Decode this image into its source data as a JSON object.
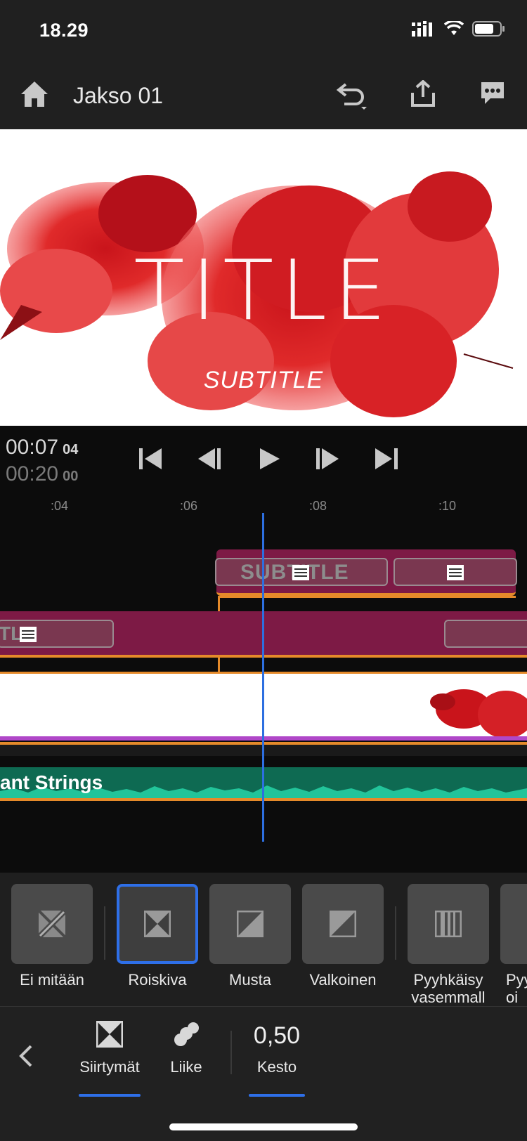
{
  "status": {
    "time": "18.29"
  },
  "header": {
    "title": "Jakso 01"
  },
  "preview": {
    "title": "TITLE",
    "subtitle": "SUBTITLE"
  },
  "transport": {
    "current": "00:07",
    "current_frames": "04",
    "total": "00:20",
    "total_frames": "00"
  },
  "ruler": {
    "ticks": [
      ":04",
      ":06",
      ":08",
      ":10"
    ]
  },
  "timeline": {
    "subtitle_clip": "SUBTITLE",
    "title_clip": "TL",
    "audio_clip": "ant Strings"
  },
  "transitions": [
    {
      "label": "Ei mitään",
      "icon": "no-transition-icon"
    },
    {
      "label": "Roiskiva",
      "icon": "cross-dissolve-icon",
      "selected": true
    },
    {
      "label": "Musta",
      "icon": "dip-black-icon"
    },
    {
      "label": "Valkoinen",
      "icon": "dip-white-icon"
    },
    {
      "label": "Pyyhkäisy vasemmall",
      "icon": "wipe-left-icon"
    },
    {
      "label": "Pyy oi",
      "icon": "wipe-right-icon"
    }
  ],
  "bottom": {
    "transitions_label": "Siirtymät",
    "motion_label": "Liike",
    "duration_value": "0,50",
    "duration_label": "Kesto"
  },
  "colors": {
    "accent": "#2e6fe8",
    "clip": "#7d1a45",
    "audio": "#0e6a52",
    "trim": "#e58a2a"
  }
}
